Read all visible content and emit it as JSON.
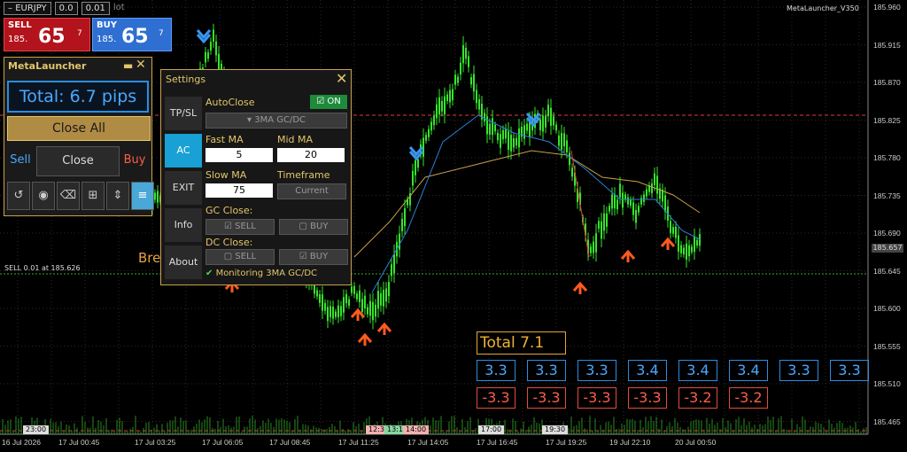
{
  "ticker": {
    "symbol": "EURJPY",
    "spread": "0.0",
    "lot": "0.01",
    "lot_label": "lot"
  },
  "sell": {
    "label": "SELL",
    "small": "185.",
    "big": "65",
    "sup": "7"
  },
  "buy": {
    "label": "BUY",
    "small": "185.",
    "big": "65",
    "sup": "7"
  },
  "metalauncher": {
    "title": "MetaLauncher",
    "total": "Total: 6.7 pips",
    "close_all": "Close All",
    "sell": "Sell",
    "close": "Close",
    "buy": "Buy"
  },
  "settings": {
    "title": "Settings",
    "tabs": [
      "TP/SL",
      "AC",
      "EXIT",
      "Info",
      "About"
    ],
    "autoclose": "AutoClose",
    "on": "ON",
    "mode": "3MA GC/DC",
    "fast_ma_label": "Fast MA",
    "fast_ma": "5",
    "mid_ma_label": "Mid MA",
    "mid_ma": "20",
    "slow_ma_label": "Slow MA",
    "slow_ma": "75",
    "timeframe_label": "Timeframe",
    "timeframe": "Current",
    "gc_close": "GC Close:",
    "dc_close": "DC Close:",
    "sell": "SELL",
    "buy": "BUY",
    "monitoring": "Monitoring 3MA GC/DC"
  },
  "overlay": {
    "bre": "Bre",
    "sline": "SELL 0.01 at 185.626",
    "version": "MetaLauncher_V350"
  },
  "summary": {
    "total": "Total 7.1",
    "positive": [
      "3.3",
      "3.3",
      "3.3",
      "3.4",
      "3.4",
      "3.4",
      "3.3",
      "3.3"
    ],
    "negative": [
      "-3.3",
      "-3.3",
      "-3.3",
      "-3.3",
      "-3.2",
      "-3.2"
    ]
  },
  "axis": {
    "prices": [
      "185.960",
      "185.915",
      "185.870",
      "185.825",
      "185.780",
      "185.735",
      "185.690",
      "185.645",
      "185.600",
      "185.555",
      "185.510",
      "185.465"
    ],
    "current_price": "185.657",
    "times": [
      "16 Jul 2026",
      "17 Jul 00:45",
      "17 Jul 03:25",
      "17 Jul 06:05",
      "17 Jul 08:45",
      "17 Jul 11:25",
      "17 Jul 14:05",
      "17 Jul 16:45",
      "17 Jul 19:25",
      "19 Jul 22:10",
      "20 Jul 00:50"
    ],
    "time_tags": [
      "23:00",
      "12:30",
      "13:15",
      "14:00",
      "17:00",
      "19:30"
    ]
  },
  "colors": {
    "accent": "#c9a14a",
    "sell": "#b3131c",
    "buy": "#2e6fd1",
    "bull": "#35e62a",
    "active_tab": "#19a0d4"
  }
}
